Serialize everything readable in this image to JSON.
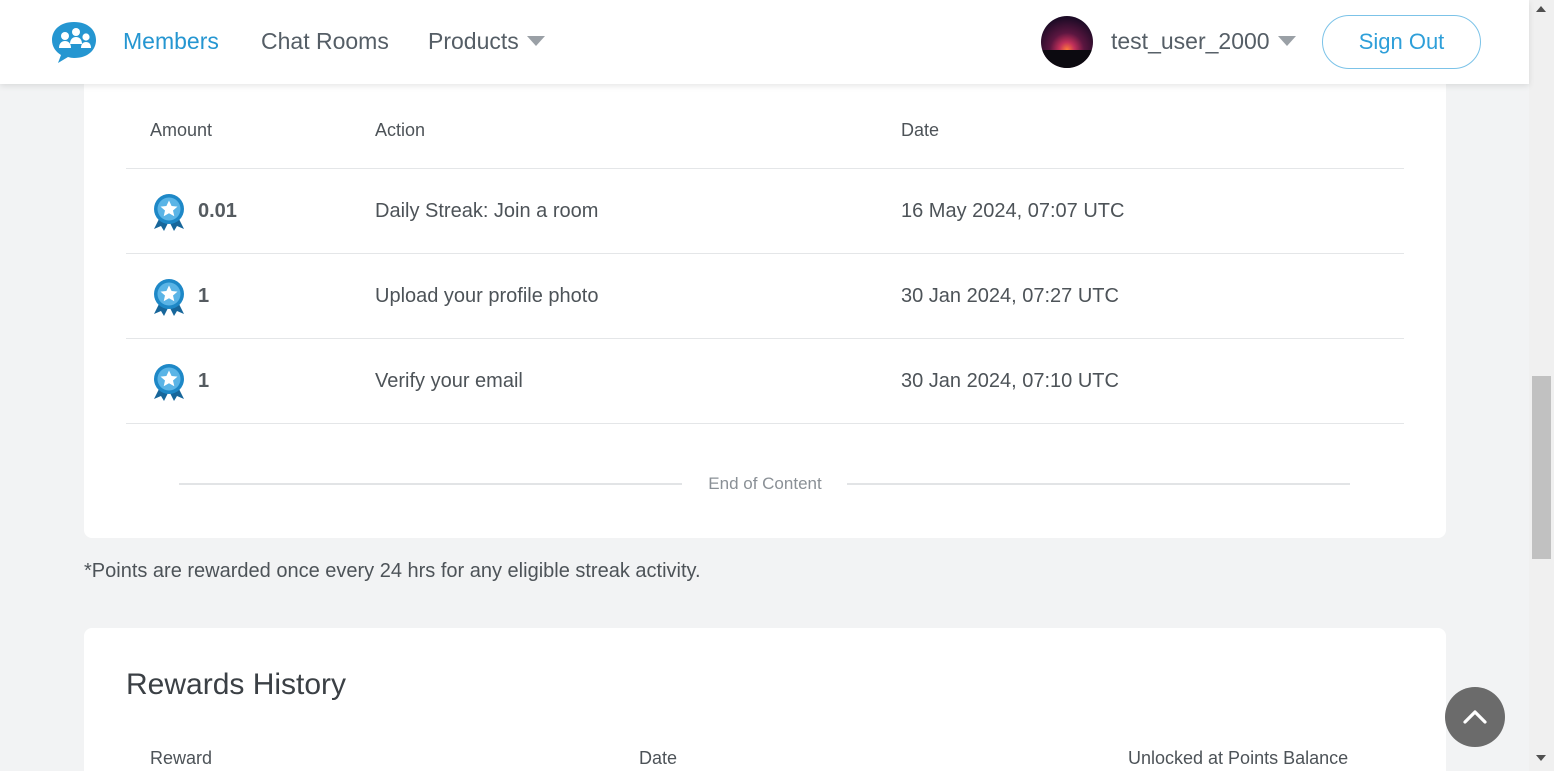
{
  "nav": {
    "items": [
      {
        "label": "Members",
        "active": true
      },
      {
        "label": "Chat Rooms",
        "active": false
      },
      {
        "label": "Products",
        "active": false
      }
    ],
    "username": "test_user_2000",
    "sign_out_label": "Sign Out"
  },
  "points_table": {
    "headers": {
      "amount": "Amount",
      "action": "Action",
      "date": "Date"
    },
    "rows": [
      {
        "amount": "0.01",
        "action": "Daily Streak: Join a room",
        "date": "16 May 2024, 07:07 UTC"
      },
      {
        "amount": "1",
        "action": "Upload your profile photo",
        "date": "30 Jan 2024, 07:27 UTC"
      },
      {
        "amount": "1",
        "action": "Verify your email",
        "date": "30 Jan 2024, 07:10 UTC"
      }
    ],
    "end_text": "End of Content"
  },
  "footnote": "*Points are rewarded once every 24 hrs for any eligible streak activity.",
  "rewards_history": {
    "title": "Rewards History",
    "headers": {
      "reward": "Reward",
      "date": "Date",
      "unlocked": "Unlocked at Points Balance"
    }
  },
  "colors": {
    "accent": "#2596d1",
    "badge": "#1e88c7",
    "background": "#f2f3f4"
  },
  "icons": {
    "logo": "chat-bubbles-logo",
    "badge": "star-badge-icon",
    "back_to_top": "chevron-up-icon"
  }
}
